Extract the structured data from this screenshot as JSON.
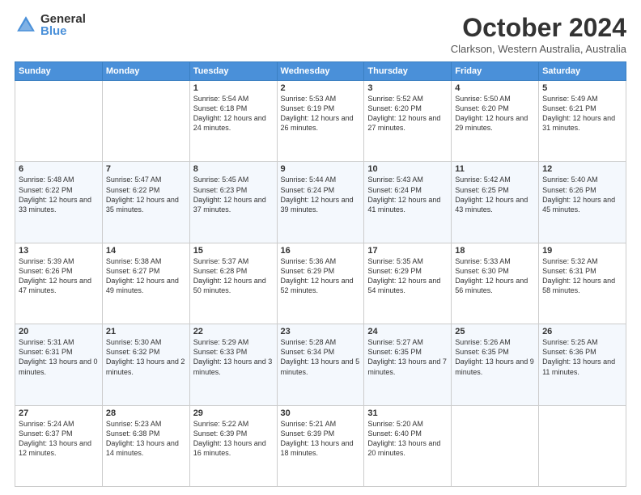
{
  "header": {
    "logo": {
      "general": "General",
      "blue": "Blue"
    },
    "title": "October 2024",
    "location": "Clarkson, Western Australia, Australia"
  },
  "days_of_week": [
    "Sunday",
    "Monday",
    "Tuesday",
    "Wednesday",
    "Thursday",
    "Friday",
    "Saturday"
  ],
  "weeks": [
    [
      {
        "day": "",
        "info": ""
      },
      {
        "day": "",
        "info": ""
      },
      {
        "day": "1",
        "info": "Sunrise: 5:54 AM\nSunset: 6:18 PM\nDaylight: 12 hours and 24 minutes."
      },
      {
        "day": "2",
        "info": "Sunrise: 5:53 AM\nSunset: 6:19 PM\nDaylight: 12 hours and 26 minutes."
      },
      {
        "day": "3",
        "info": "Sunrise: 5:52 AM\nSunset: 6:20 PM\nDaylight: 12 hours and 27 minutes."
      },
      {
        "day": "4",
        "info": "Sunrise: 5:50 AM\nSunset: 6:20 PM\nDaylight: 12 hours and 29 minutes."
      },
      {
        "day": "5",
        "info": "Sunrise: 5:49 AM\nSunset: 6:21 PM\nDaylight: 12 hours and 31 minutes."
      }
    ],
    [
      {
        "day": "6",
        "info": "Sunrise: 5:48 AM\nSunset: 6:22 PM\nDaylight: 12 hours and 33 minutes."
      },
      {
        "day": "7",
        "info": "Sunrise: 5:47 AM\nSunset: 6:22 PM\nDaylight: 12 hours and 35 minutes."
      },
      {
        "day": "8",
        "info": "Sunrise: 5:45 AM\nSunset: 6:23 PM\nDaylight: 12 hours and 37 minutes."
      },
      {
        "day": "9",
        "info": "Sunrise: 5:44 AM\nSunset: 6:24 PM\nDaylight: 12 hours and 39 minutes."
      },
      {
        "day": "10",
        "info": "Sunrise: 5:43 AM\nSunset: 6:24 PM\nDaylight: 12 hours and 41 minutes."
      },
      {
        "day": "11",
        "info": "Sunrise: 5:42 AM\nSunset: 6:25 PM\nDaylight: 12 hours and 43 minutes."
      },
      {
        "day": "12",
        "info": "Sunrise: 5:40 AM\nSunset: 6:26 PM\nDaylight: 12 hours and 45 minutes."
      }
    ],
    [
      {
        "day": "13",
        "info": "Sunrise: 5:39 AM\nSunset: 6:26 PM\nDaylight: 12 hours and 47 minutes."
      },
      {
        "day": "14",
        "info": "Sunrise: 5:38 AM\nSunset: 6:27 PM\nDaylight: 12 hours and 49 minutes."
      },
      {
        "day": "15",
        "info": "Sunrise: 5:37 AM\nSunset: 6:28 PM\nDaylight: 12 hours and 50 minutes."
      },
      {
        "day": "16",
        "info": "Sunrise: 5:36 AM\nSunset: 6:29 PM\nDaylight: 12 hours and 52 minutes."
      },
      {
        "day": "17",
        "info": "Sunrise: 5:35 AM\nSunset: 6:29 PM\nDaylight: 12 hours and 54 minutes."
      },
      {
        "day": "18",
        "info": "Sunrise: 5:33 AM\nSunset: 6:30 PM\nDaylight: 12 hours and 56 minutes."
      },
      {
        "day": "19",
        "info": "Sunrise: 5:32 AM\nSunset: 6:31 PM\nDaylight: 12 hours and 58 minutes."
      }
    ],
    [
      {
        "day": "20",
        "info": "Sunrise: 5:31 AM\nSunset: 6:31 PM\nDaylight: 13 hours and 0 minutes."
      },
      {
        "day": "21",
        "info": "Sunrise: 5:30 AM\nSunset: 6:32 PM\nDaylight: 13 hours and 2 minutes."
      },
      {
        "day": "22",
        "info": "Sunrise: 5:29 AM\nSunset: 6:33 PM\nDaylight: 13 hours and 3 minutes."
      },
      {
        "day": "23",
        "info": "Sunrise: 5:28 AM\nSunset: 6:34 PM\nDaylight: 13 hours and 5 minutes."
      },
      {
        "day": "24",
        "info": "Sunrise: 5:27 AM\nSunset: 6:35 PM\nDaylight: 13 hours and 7 minutes."
      },
      {
        "day": "25",
        "info": "Sunrise: 5:26 AM\nSunset: 6:35 PM\nDaylight: 13 hours and 9 minutes."
      },
      {
        "day": "26",
        "info": "Sunrise: 5:25 AM\nSunset: 6:36 PM\nDaylight: 13 hours and 11 minutes."
      }
    ],
    [
      {
        "day": "27",
        "info": "Sunrise: 5:24 AM\nSunset: 6:37 PM\nDaylight: 13 hours and 12 minutes."
      },
      {
        "day": "28",
        "info": "Sunrise: 5:23 AM\nSunset: 6:38 PM\nDaylight: 13 hours and 14 minutes."
      },
      {
        "day": "29",
        "info": "Sunrise: 5:22 AM\nSunset: 6:39 PM\nDaylight: 13 hours and 16 minutes."
      },
      {
        "day": "30",
        "info": "Sunrise: 5:21 AM\nSunset: 6:39 PM\nDaylight: 13 hours and 18 minutes."
      },
      {
        "day": "31",
        "info": "Sunrise: 5:20 AM\nSunset: 6:40 PM\nDaylight: 13 hours and 20 minutes."
      },
      {
        "day": "",
        "info": ""
      },
      {
        "day": "",
        "info": ""
      }
    ]
  ]
}
